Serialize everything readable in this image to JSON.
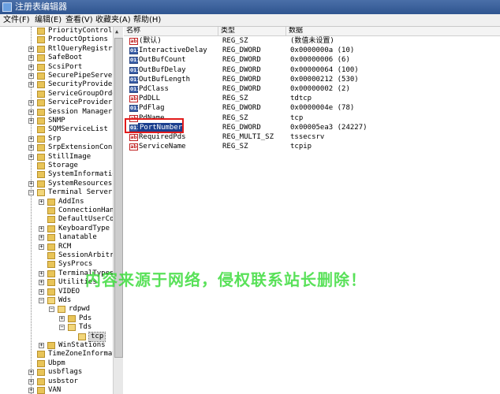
{
  "window": {
    "title": "注册表编辑器"
  },
  "menu": [
    "文件(F)",
    "编辑(E)",
    "查看(V)",
    "收藏夹(A)",
    "帮助(H)"
  ],
  "tree": [
    {
      "label": "PriorityControl",
      "depth": 0,
      "expander": "none"
    },
    {
      "label": "ProductOptions",
      "depth": 0,
      "expander": "none"
    },
    {
      "label": "RtlQueryRegistryCor",
      "depth": 0,
      "expander": "plus"
    },
    {
      "label": "SafeBoot",
      "depth": 0,
      "expander": "plus"
    },
    {
      "label": "ScsiPort",
      "depth": 0,
      "expander": "plus"
    },
    {
      "label": "SecurePipeServers",
      "depth": 0,
      "expander": "plus"
    },
    {
      "label": "SecurityProviders",
      "depth": 0,
      "expander": "plus"
    },
    {
      "label": "ServiceGroupOrder",
      "depth": 0,
      "expander": "none"
    },
    {
      "label": "ServiceProvider",
      "depth": 0,
      "expander": "plus"
    },
    {
      "label": "Session Manager",
      "depth": 0,
      "expander": "plus"
    },
    {
      "label": "SNMP",
      "depth": 0,
      "expander": "plus"
    },
    {
      "label": "SQMServiceList",
      "depth": 0,
      "expander": "none"
    },
    {
      "label": "Srp",
      "depth": 0,
      "expander": "plus"
    },
    {
      "label": "SrpExtensionConfig",
      "depth": 0,
      "expander": "plus"
    },
    {
      "label": "StillImage",
      "depth": 0,
      "expander": "plus"
    },
    {
      "label": "Storage",
      "depth": 0,
      "expander": "none"
    },
    {
      "label": "SystemInformation",
      "depth": 0,
      "expander": "none"
    },
    {
      "label": "SystemResources",
      "depth": 0,
      "expander": "plus"
    },
    {
      "label": "Terminal Server",
      "depth": 0,
      "expander": "minus"
    },
    {
      "label": "AddIns",
      "depth": 1,
      "expander": "plus"
    },
    {
      "label": "ConnectionHandle",
      "depth": 1,
      "expander": "none"
    },
    {
      "label": "DefaultUserConfi",
      "depth": 1,
      "expander": "none"
    },
    {
      "label": "KeyboardType Maj",
      "depth": 1,
      "expander": "plus"
    },
    {
      "label": "lanatable",
      "depth": 1,
      "expander": "plus"
    },
    {
      "label": "RCM",
      "depth": 1,
      "expander": "plus"
    },
    {
      "label": "SessionArbitrati",
      "depth": 1,
      "expander": "none"
    },
    {
      "label": "SysProcs",
      "depth": 1,
      "expander": "none"
    },
    {
      "label": "TerminalTypes",
      "depth": 1,
      "expander": "plus"
    },
    {
      "label": "Utilities",
      "depth": 1,
      "expander": "plus"
    },
    {
      "label": "VIDEO",
      "depth": 1,
      "expander": "plus"
    },
    {
      "label": "Wds",
      "depth": 1,
      "expander": "minus"
    },
    {
      "label": "rdpwd",
      "depth": 2,
      "expander": "minus"
    },
    {
      "label": "Pds",
      "depth": 3,
      "expander": "plus"
    },
    {
      "label": "Tds",
      "depth": 3,
      "expander": "minus"
    },
    {
      "label": "tcp",
      "depth": 4,
      "expander": "none",
      "selected": true
    },
    {
      "label": "WinStations",
      "depth": 1,
      "expander": "plus"
    },
    {
      "label": "TimeZoneInformation",
      "depth": 0,
      "expander": "none"
    },
    {
      "label": "Ubpm",
      "depth": 0,
      "expander": "none"
    },
    {
      "label": "usbflags",
      "depth": 0,
      "expander": "plus"
    },
    {
      "label": "usbstor",
      "depth": 0,
      "expander": "plus"
    },
    {
      "label": "VAN",
      "depth": 0,
      "expander": "plus"
    }
  ],
  "columns": {
    "name": "名称",
    "type": "类型",
    "data": "数据"
  },
  "values": [
    {
      "icon": "sz",
      "name": "(默认)",
      "type": "REG_SZ",
      "data": "(数值未设置)"
    },
    {
      "icon": "bin",
      "name": "InteractiveDelay",
      "type": "REG_DWORD",
      "data": "0x0000000a (10)"
    },
    {
      "icon": "bin",
      "name": "OutBufCount",
      "type": "REG_DWORD",
      "data": "0x00000006 (6)"
    },
    {
      "icon": "bin",
      "name": "OutBufDelay",
      "type": "REG_DWORD",
      "data": "0x00000064 (100)"
    },
    {
      "icon": "bin",
      "name": "OutBufLength",
      "type": "REG_DWORD",
      "data": "0x00000212 (530)"
    },
    {
      "icon": "bin",
      "name": "PdClass",
      "type": "REG_DWORD",
      "data": "0x00000002 (2)"
    },
    {
      "icon": "sz",
      "name": "PdDLL",
      "type": "REG_SZ",
      "data": "tdtcp"
    },
    {
      "icon": "bin",
      "name": "PdFlag",
      "type": "REG_DWORD",
      "data": "0x0000004e (78)"
    },
    {
      "icon": "sz",
      "name": "PdName",
      "type": "REG_SZ",
      "data": "tcp"
    },
    {
      "icon": "bin",
      "name": "PortNumber",
      "type": "REG_DWORD",
      "data": "0x00005ea3 (24227)",
      "highlighted": true
    },
    {
      "icon": "sz",
      "name": "RequiredPds",
      "type": "REG_MULTI_SZ",
      "data": "tssecsrv"
    },
    {
      "icon": "sz",
      "name": "ServiceName",
      "type": "REG_SZ",
      "data": "tcpip"
    }
  ],
  "icons": {
    "string_value": "ab",
    "binary_value": "011"
  },
  "watermark": "内容来源于网络，侵权联系站长删除！"
}
